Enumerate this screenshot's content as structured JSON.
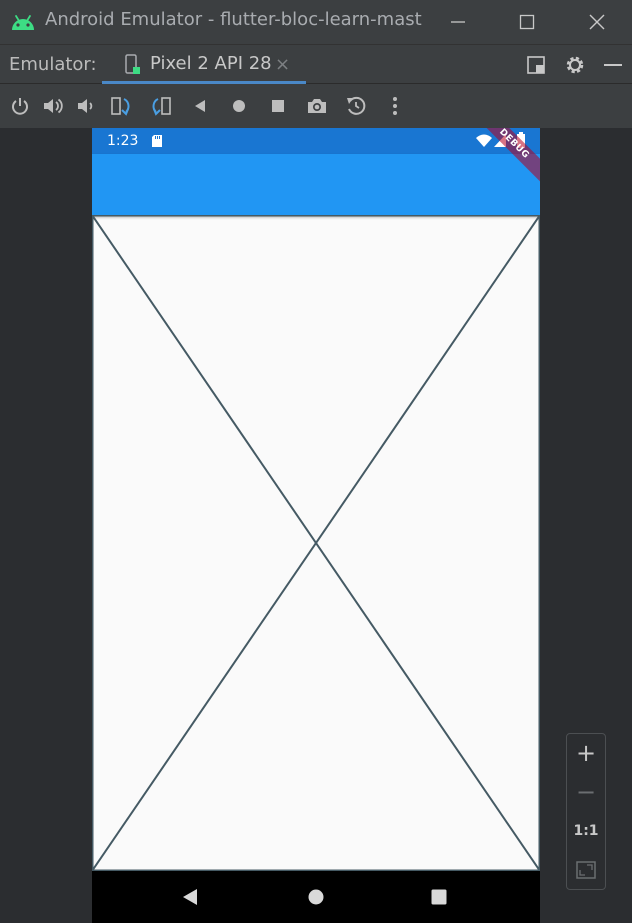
{
  "window": {
    "title": "Android Emulator - flutter-bloc-learn-mast",
    "minimize_icon": "minimize-icon",
    "maximize_icon": "maximize-icon",
    "close_icon": "close-icon"
  },
  "tabs_bar": {
    "label": "Emulator:",
    "tabs": [
      {
        "label": "Pixel 2 API 28",
        "close": "×"
      }
    ],
    "right_icons": [
      "snapshot-window-icon",
      "gear-icon",
      "hide-icon"
    ]
  },
  "toolbar": {
    "icons": [
      "power-icon",
      "volume-up-icon",
      "volume-down-icon",
      "rotate-left-icon",
      "rotate-right-icon",
      "back-icon",
      "home-icon",
      "overview-icon",
      "screenshot-icon",
      "snapshot-icon",
      "more-icon"
    ]
  },
  "device": {
    "status_time": "1:23",
    "debug_banner": "DEBUG",
    "colors": {
      "status_bar": "#1976d2",
      "app_bar": "#2196f3",
      "body": "#fafafa"
    }
  },
  "zoom": {
    "plus": "+",
    "minus": "−",
    "actual_size": "1:1"
  }
}
